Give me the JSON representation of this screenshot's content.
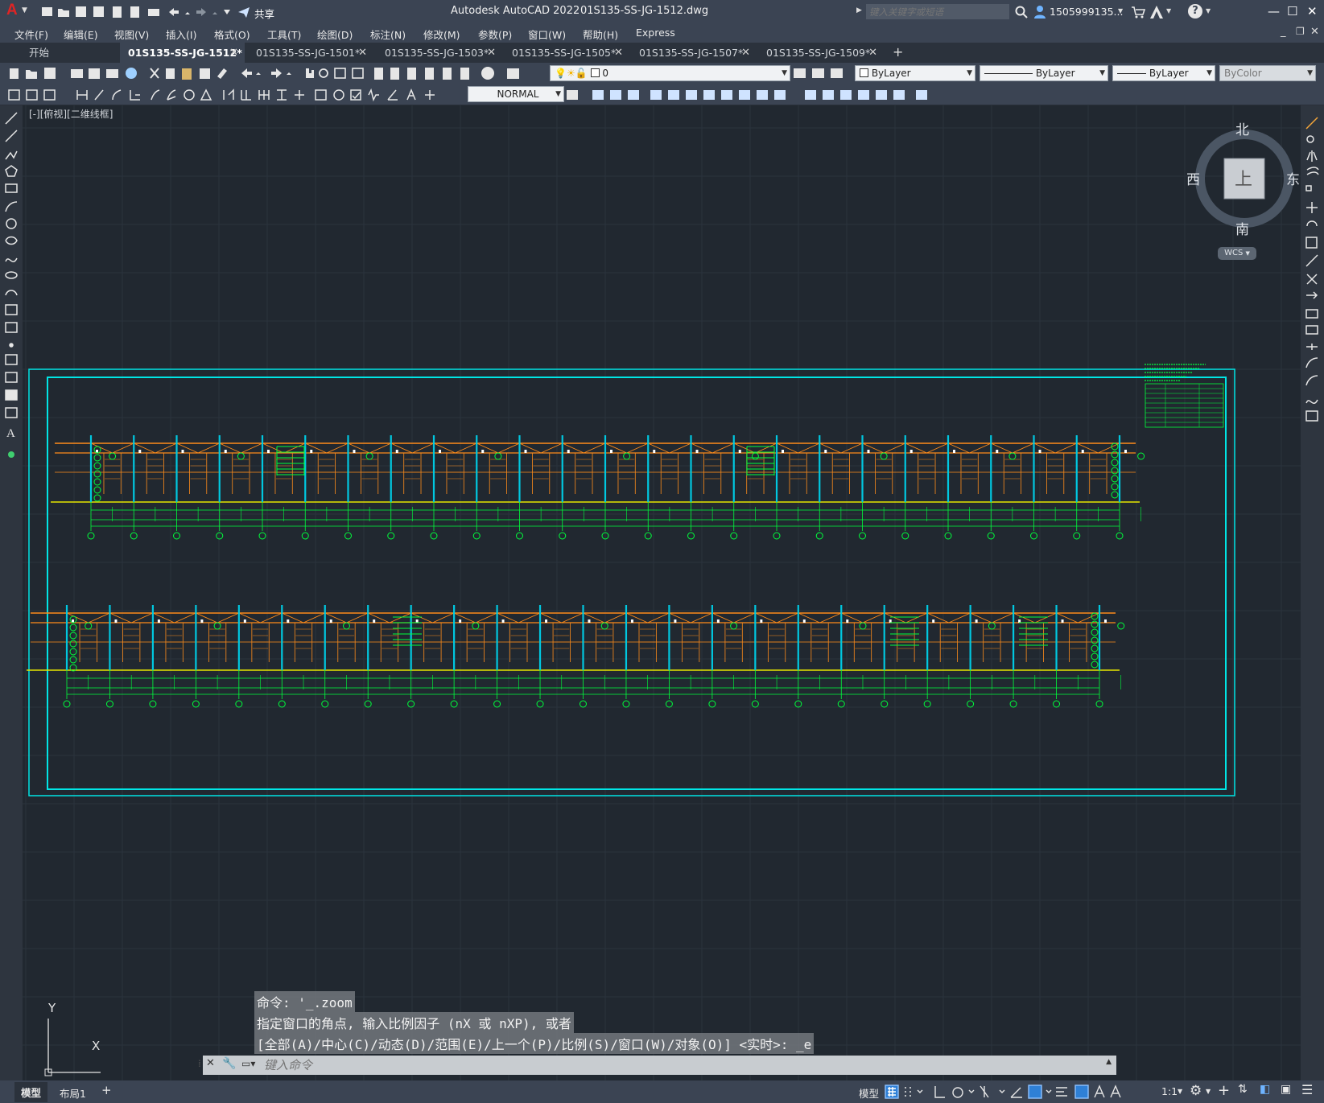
{
  "app": {
    "title": "Autodesk AutoCAD 2022",
    "filename": "01S135-SS-JG-1512.dwg",
    "logo_letter": "A",
    "share_label": "共享",
    "search_placeholder": "键入关键字或短语",
    "user": "1505999135...",
    "help_label": "?"
  },
  "menu": [
    "文件(F)",
    "编辑(E)",
    "视图(V)",
    "插入(I)",
    "格式(O)",
    "工具(T)",
    "绘图(D)",
    "标注(N)",
    "修改(M)",
    "参数(P)",
    "窗口(W)",
    "帮助(H)",
    "Express"
  ],
  "tabs": [
    {
      "label": "开始",
      "active": false,
      "closable": false
    },
    {
      "label": "01S135-SS-JG-1512*",
      "active": true,
      "closable": true
    },
    {
      "label": "01S135-SS-JG-1501*",
      "active": false,
      "closable": true
    },
    {
      "label": "01S135-SS-JG-1503*",
      "active": false,
      "closable": true
    },
    {
      "label": "01S135-SS-JG-1505*",
      "active": false,
      "closable": true
    },
    {
      "label": "01S135-SS-JG-1507*",
      "active": false,
      "closable": true
    },
    {
      "label": "01S135-SS-JG-1509*",
      "active": false,
      "closable": true
    }
  ],
  "tab_add": "+",
  "properties": {
    "layer": "0",
    "color": "ByLayer",
    "linetype": "ByLayer",
    "lineweight": "ByLayer",
    "plotstyle": "ByColor",
    "dimstyle": "NORMAL"
  },
  "viewport": {
    "label": "[-][俯视][二维线框]",
    "viewcube": {
      "north": "北",
      "south": "南",
      "east": "东",
      "west": "西",
      "face": "上",
      "wcs": "WCS"
    },
    "ucs": {
      "x": "X",
      "y": "Y"
    }
  },
  "drawing": {
    "upper_grid_count": 25,
    "lower_grid_count": 25,
    "colors": {
      "frame": "#00e5e5",
      "beam": "#ff8c1a",
      "grid": "#00ff3c",
      "column": "#00c8e0",
      "white": "#ffffff",
      "yellow": "#e6e600"
    }
  },
  "command": {
    "history": [
      "命令: '_.zoom",
      "指定窗口的角点, 输入比例因子 (nX 或 nXP), 或者",
      "[全部(A)/中心(C)/动态(D)/范围(E)/上一个(P)/比例(S)/窗口(W)/对象(O)] <实时>: _e"
    ],
    "placeholder": "键入命令"
  },
  "layouts": {
    "model": "模型",
    "layout1": "布局1",
    "add": "+"
  },
  "status": {
    "model_label": "模型",
    "scale": "1:1"
  }
}
